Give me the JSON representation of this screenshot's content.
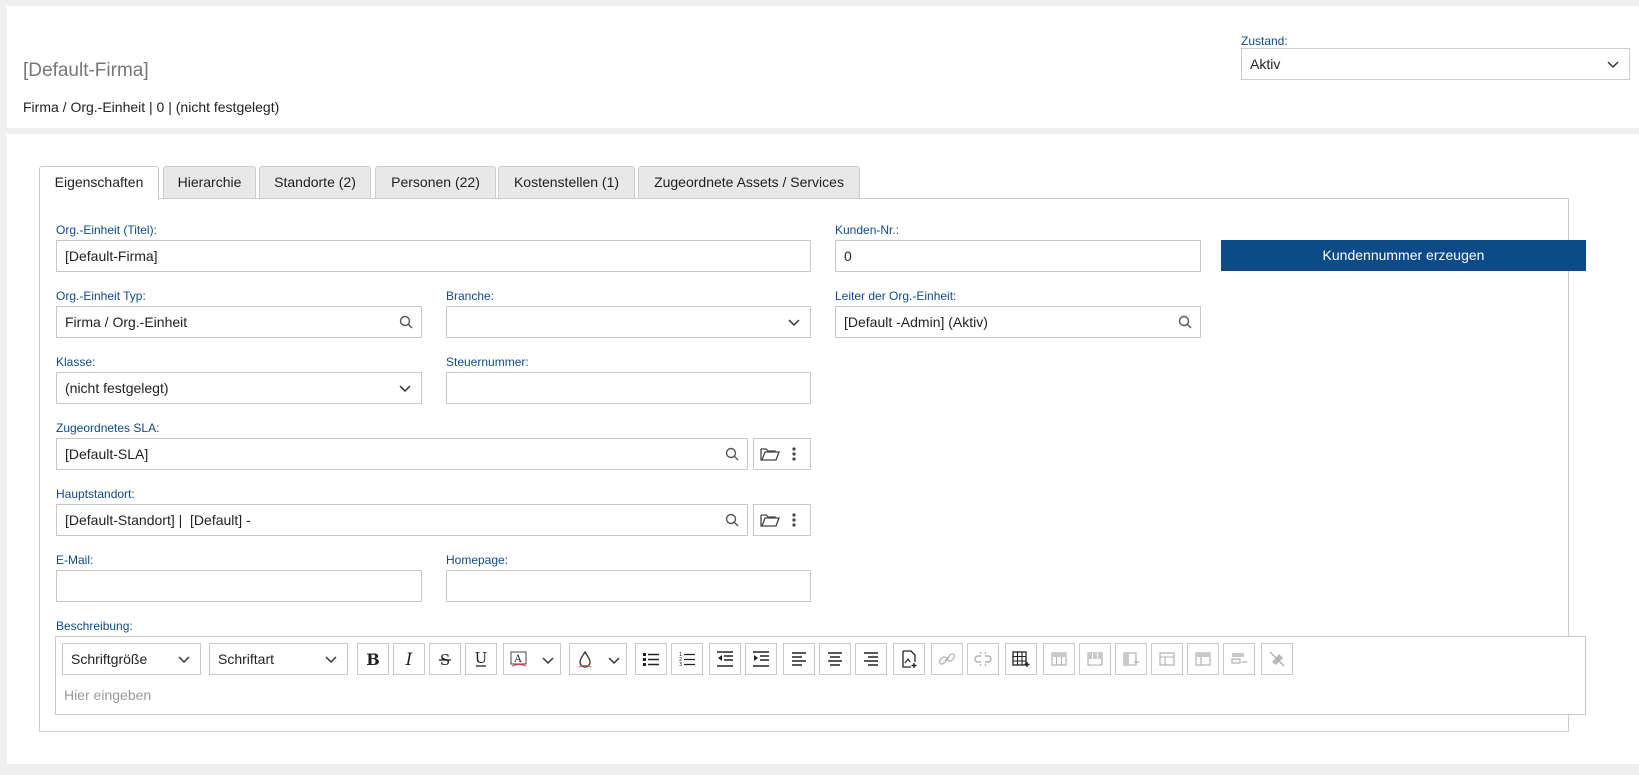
{
  "header": {
    "title": "[Default-Firma]",
    "subtitle": "Firma / Org.-Einheit | 0 | (nicht festgelegt)",
    "zustand_label": "Zustand:",
    "zustand_value": "Aktiv"
  },
  "tabs": [
    {
      "label": "Eigenschaften",
      "active": true
    },
    {
      "label": "Hierarchie"
    },
    {
      "label": "Standorte (2)"
    },
    {
      "label": "Personen (22)"
    },
    {
      "label": "Kostenstellen (1)"
    },
    {
      "label": "Zugeordnete Assets / Services"
    }
  ],
  "form": {
    "org_title_label": "Org.-Einheit (Titel):",
    "org_title_value": "[Default-Firma]",
    "kunden_nr_label": "Kunden-Nr.:",
    "kunden_nr_value": "0",
    "generate_button": "Kundennummer erzeugen",
    "org_typ_label": "Org.-Einheit Typ:",
    "org_typ_value": "Firma / Org.-Einheit",
    "branche_label": "Branche:",
    "branche_value": "",
    "leiter_label": "Leiter der Org.-Einheit:",
    "leiter_value": "[Default -Admin] (Aktiv)",
    "klasse_label": "Klasse:",
    "klasse_value": "(nicht festgelegt)",
    "steuer_label": "Steuernummer:",
    "steuer_value": "",
    "sla_label": "Zugeordnetes SLA:",
    "sla_value": "[Default-SLA]",
    "hauptstandort_label": "Hauptstandort:",
    "hauptstandort_value": "[Default-Standort] |  [Default] -",
    "email_label": "E-Mail:",
    "email_value": "",
    "homepage_label": "Homepage:",
    "homepage_value": "",
    "beschreibung_label": "Beschreibung:"
  },
  "editor": {
    "font_size_select": "Schriftgröße",
    "font_family_select": "Schriftart",
    "placeholder": "Hier eingeben"
  },
  "colors": {
    "accent": "#0d4a88",
    "label": "#0d4a88",
    "border": "#c8c8c8",
    "page_bg": "#efefef"
  }
}
